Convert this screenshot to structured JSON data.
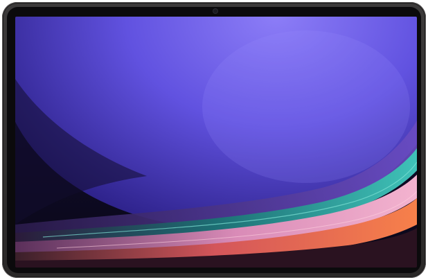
{
  "device": {
    "type": "tablet",
    "frame_color": "#353333",
    "bezel_color": "#0b0a0c"
  },
  "wallpaper": {
    "description_colors": {
      "sphere_light": "#7a6cf0",
      "sphere_dark": "#2a1f8a",
      "background": "#0b0820",
      "teal_band": "#1f8a86",
      "pink_band": "#e58ab3",
      "orange_band": "#f0704a"
    }
  }
}
